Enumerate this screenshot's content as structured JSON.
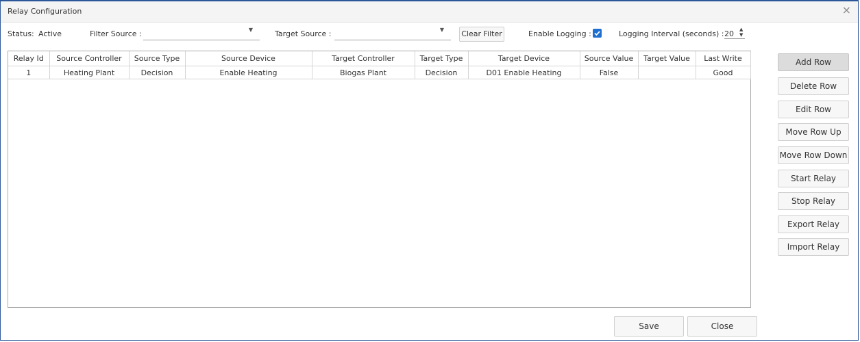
{
  "window": {
    "title": "Relay Configuration",
    "close_glyph": "×"
  },
  "toolbar": {
    "status_label": "Status:",
    "status_value": "Active",
    "filter_source_label": "Filter Source :",
    "filter_source_value": "",
    "target_source_label": "Target Source :",
    "target_source_value": "",
    "clear_filter_label": "Clear Filter",
    "enable_logging_label": "Enable Logging :",
    "enable_logging_checked": true,
    "logging_interval_label": "Logging Interval (seconds) :",
    "logging_interval_value": "20",
    "accent_color": "#1f6fd1"
  },
  "table": {
    "columns": [
      "Relay Id",
      "Source Controller",
      "Source Type",
      "Source Device",
      "Target Controller",
      "Target Type",
      "Target Device",
      "Source Value",
      "Target Value",
      "Last Write"
    ],
    "rows": [
      [
        "1",
        "Heating Plant",
        "Decision",
        "Enable Heating",
        "Biogas Plant",
        "Decision",
        "D01 Enable Heating",
        "False",
        "",
        "Good"
      ]
    ]
  },
  "actions": [
    "Add Row",
    "Delete Row",
    "Edit Row",
    "Move Row Up",
    "Move Row Down",
    "Start Relay",
    "Stop Relay",
    "Export Relay",
    "Import Relay"
  ],
  "footer": {
    "save_label": "Save",
    "close_label": "Close"
  }
}
